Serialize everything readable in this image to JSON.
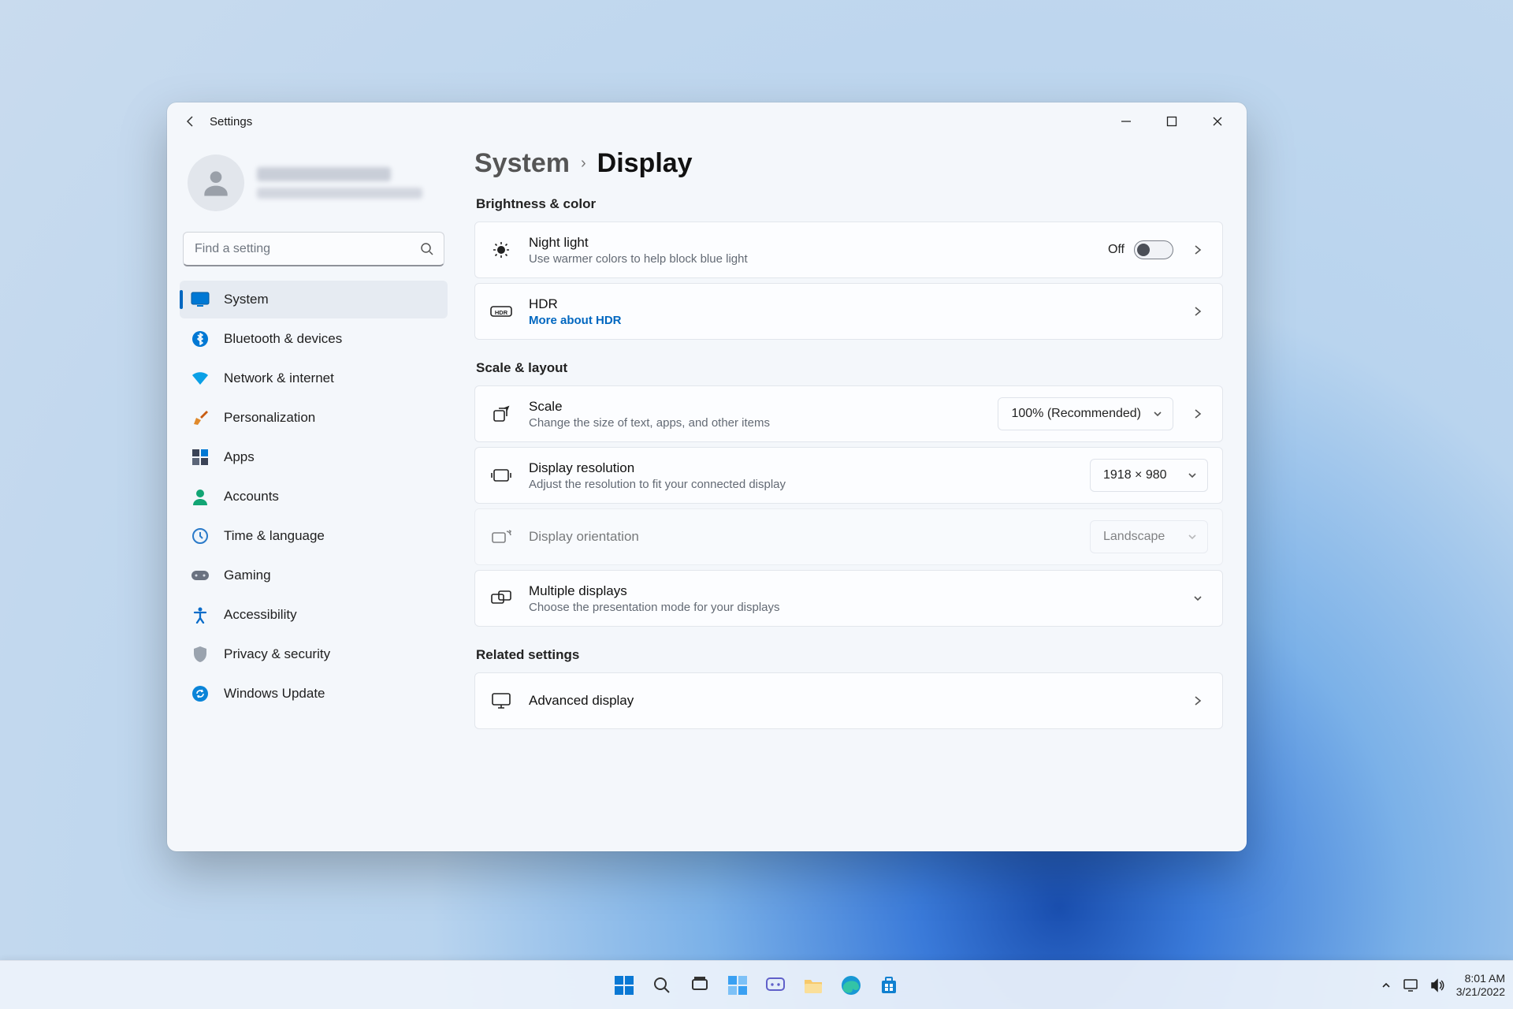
{
  "window": {
    "app_title": "Settings"
  },
  "search": {
    "placeholder": "Find a setting"
  },
  "sidebar": {
    "items": [
      {
        "label": "System"
      },
      {
        "label": "Bluetooth & devices"
      },
      {
        "label": "Network & internet"
      },
      {
        "label": "Personalization"
      },
      {
        "label": "Apps"
      },
      {
        "label": "Accounts"
      },
      {
        "label": "Time & language"
      },
      {
        "label": "Gaming"
      },
      {
        "label": "Accessibility"
      },
      {
        "label": "Privacy & security"
      },
      {
        "label": "Windows Update"
      }
    ]
  },
  "breadcrumb": {
    "root": "System",
    "page": "Display"
  },
  "sections": {
    "brightness": {
      "title": "Brightness & color",
      "night_light": {
        "title": "Night light",
        "desc": "Use warmer colors to help block blue light",
        "state_label": "Off"
      },
      "hdr": {
        "title": "HDR",
        "link": "More about HDR"
      }
    },
    "scale": {
      "title": "Scale & layout",
      "scale": {
        "title": "Scale",
        "desc": "Change the size of text, apps, and other items",
        "value": "100% (Recommended)"
      },
      "resolution": {
        "title": "Display resolution",
        "desc": "Adjust the resolution to fit your connected display",
        "value": "1918 × 980"
      },
      "orientation": {
        "title": "Display orientation",
        "value": "Landscape"
      },
      "multiple": {
        "title": "Multiple displays",
        "desc": "Choose the presentation mode for your displays"
      }
    },
    "related": {
      "title": "Related settings",
      "advanced": {
        "title": "Advanced display"
      }
    }
  },
  "tray": {
    "time": "8:01 AM",
    "date": "3/21/2022"
  }
}
